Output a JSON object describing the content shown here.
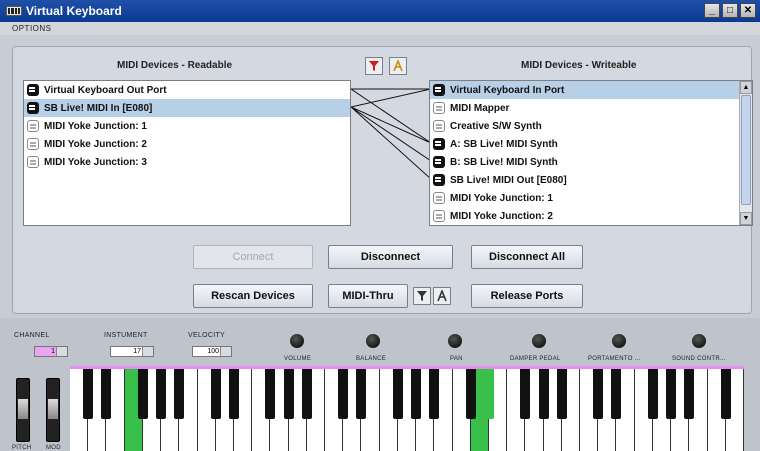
{
  "window": {
    "title": "Virtual Keyboard",
    "minimize": "_",
    "maximize": "□",
    "close": "✕"
  },
  "menu": {
    "options": "OPTIONS"
  },
  "readable": {
    "title": "MIDI Devices - Readable",
    "items": [
      {
        "label": "Virtual Keyboard Out Port",
        "active": true,
        "selected": false
      },
      {
        "label": "SB Live! MIDI In [E080]",
        "active": true,
        "selected": true
      },
      {
        "label": "MIDI Yoke Junction:  1",
        "active": false,
        "selected": false
      },
      {
        "label": "MIDI Yoke Junction:  2",
        "active": false,
        "selected": false
      },
      {
        "label": "MIDI Yoke Junction:  3",
        "active": false,
        "selected": false
      }
    ]
  },
  "writeable": {
    "title": "MIDI Devices - Writeable",
    "items": [
      {
        "label": "Virtual Keyboard In Port",
        "active": true,
        "selected": true
      },
      {
        "label": "MIDI Mapper",
        "active": false,
        "selected": false
      },
      {
        "label": "Creative S/W Synth",
        "active": false,
        "selected": false
      },
      {
        "label": "A: SB Live! MIDI Synth",
        "active": true,
        "selected": false
      },
      {
        "label": "B: SB Live! MIDI Synth",
        "active": true,
        "selected": false
      },
      {
        "label": "SB Live! MIDI Out [E080]",
        "active": true,
        "selected": false
      },
      {
        "label": "MIDI Yoke Junction:  1",
        "active": false,
        "selected": false
      },
      {
        "label": "MIDI Yoke Junction:  2",
        "active": false,
        "selected": false
      }
    ]
  },
  "buttons": {
    "connect": "Connect",
    "disconnect": "Disconnect",
    "disconnect_all": "Disconnect All",
    "rescan": "Rescan Devices",
    "midi_thru": "MIDI-Thru",
    "release_ports": "Release Ports"
  },
  "controls": {
    "channel": {
      "label": "CHANNEL",
      "value": "1"
    },
    "instrument": {
      "label": "INSTUMENT",
      "value": "17"
    },
    "velocity": {
      "label": "VELOCITY",
      "value": "100"
    },
    "knobs": [
      "VOLUME",
      "BALANCE",
      "PAN",
      "DAMPER PEDAL",
      "PORTAMENTO ...",
      "SOUND CONTR..."
    ],
    "wheels": {
      "pitch": "PITCH",
      "mod": "MOD"
    }
  },
  "colors": {
    "accent_pink": "#e98cf0",
    "active_key": "#39c04a",
    "selection": "#b8cfe8"
  }
}
